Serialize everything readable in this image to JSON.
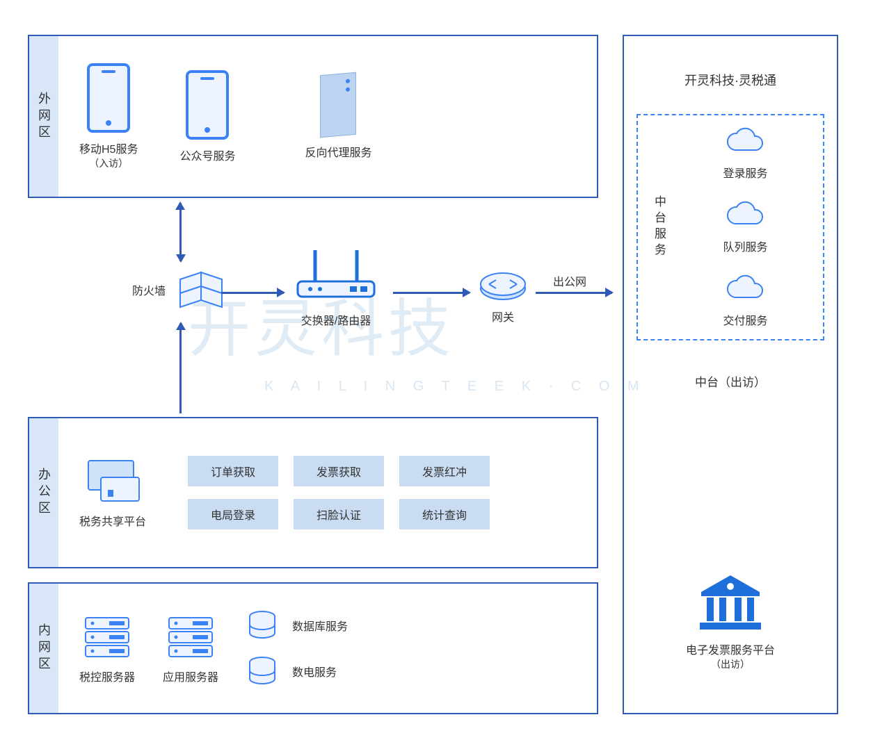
{
  "zones": {
    "external": {
      "label": "外网区",
      "items": [
        {
          "name": "移动H5服务",
          "sub": "（入访）"
        },
        {
          "name": "公众号服务"
        },
        {
          "name": "反向代理服务"
        }
      ]
    },
    "office": {
      "label": "办公区",
      "platform": "税务共享平台",
      "chips": [
        "订单获取",
        "发票获取",
        "发票红冲",
        "电局登录",
        "扫脸认证",
        "统计查询"
      ]
    },
    "internal": {
      "label": "内网区",
      "items": [
        {
          "name": "税控服务器"
        },
        {
          "name": "应用服务器"
        },
        {
          "name": "数据库服务"
        },
        {
          "name": "数电服务"
        }
      ]
    }
  },
  "middle": {
    "firewall": "防火墙",
    "router": "交换器/路由器",
    "gateway": "网关",
    "out_public": "出公网"
  },
  "right": {
    "brand": "开灵科技·灵税通",
    "midservice_label": "中台服务",
    "clouds": [
      "登录服务",
      "队列服务",
      "交付服务"
    ],
    "midplatform_out": "中台（出访）",
    "einvoice": "电子发票服务平台",
    "einvoice_sub": "（出访）"
  },
  "watermark": {
    "main": "开灵科技",
    "sub": "K A I L I N G T E E K · C O M"
  }
}
